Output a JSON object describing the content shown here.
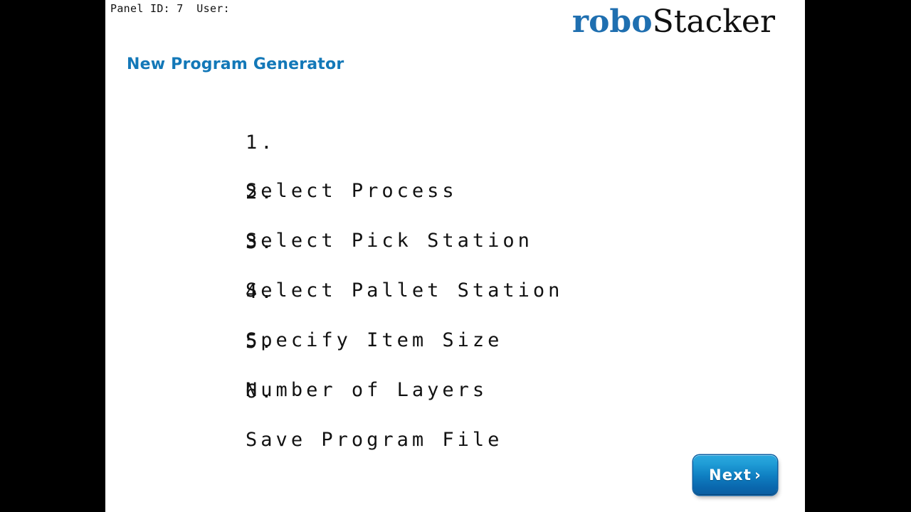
{
  "window": {
    "background_color": "#000000",
    "panel_background_color": "#ffffff"
  },
  "header": {
    "status_text": "Panel ID: 7  User:",
    "panel_id_label": "Panel ID:",
    "panel_id_value": "7",
    "user_label": "User:",
    "user_value": ""
  },
  "brand": {
    "part_one": "robo",
    "part_two": "Stacker",
    "part_one_color": "#1f6fb0",
    "part_two_color": "#101010"
  },
  "title": {
    "text": "New Program Generator",
    "color": "#1378b8"
  },
  "steps": [
    {
      "number": "1.",
      "label": "Select Process"
    },
    {
      "number": "2.",
      "label": "Select Pick Station"
    },
    {
      "number": "3.",
      "label": "Select Pallet Station"
    },
    {
      "number": "4.",
      "label": "Specify Item Size"
    },
    {
      "number": "5.",
      "label": "Number of Layers"
    },
    {
      "number": "6.",
      "label": "Save Program File"
    }
  ],
  "footer": {
    "next_label": "Next",
    "next_chevron": "›",
    "next_accent_top": "#2ba8de",
    "next_accent_bottom": "#0b5ea1"
  }
}
